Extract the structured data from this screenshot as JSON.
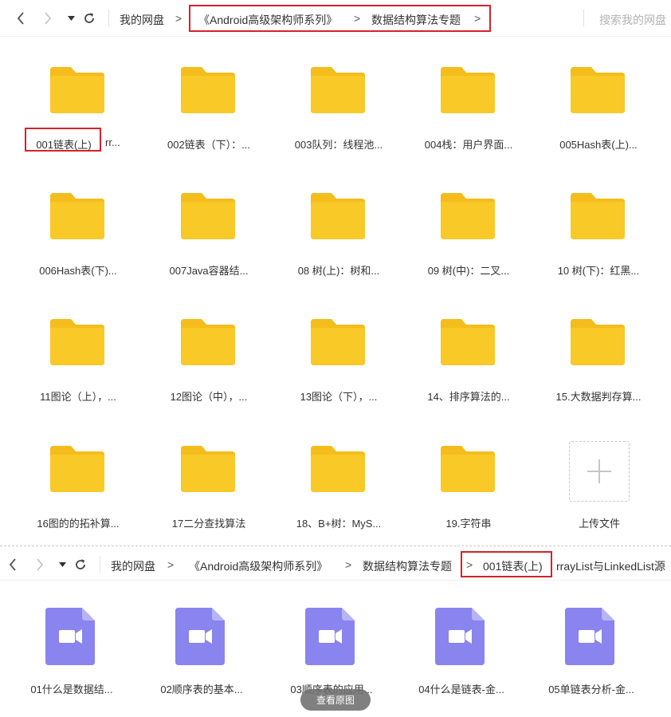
{
  "top_nav": {
    "breadcrumbs": [
      "我的网盘",
      "《Android高级架构师系列》",
      "数据结构算法专题"
    ],
    "separator": ">",
    "search_placeholder": "搜索我的网盘"
  },
  "folders": [
    {
      "name": "001链表(上)",
      "suffix": "rr..."
    },
    {
      "name": "002链表（下）：..."
    },
    {
      "name": "003队列：线程池..."
    },
    {
      "name": "004栈：用户界面..."
    },
    {
      "name": "005Hash表(上)..."
    },
    {
      "name": "006Hash表(下)..."
    },
    {
      "name": "007Java容器结..."
    },
    {
      "name": "08 树(上)：树和..."
    },
    {
      "name": "09 树(中)：二叉..."
    },
    {
      "name": "10 树(下)：红黑..."
    },
    {
      "name": "11图论（上），..."
    },
    {
      "name": "12图论（中），..."
    },
    {
      "name": "13图论（下），..."
    },
    {
      "name": "14、排序算法的..."
    },
    {
      "name": "15.大数据判存算..."
    },
    {
      "name": "16图的的拓补算..."
    },
    {
      "name": "17二分查找算法"
    },
    {
      "name": "18、B+树：MyS..."
    },
    {
      "name": "19.字符串"
    }
  ],
  "upload": {
    "label": "上传文件"
  },
  "second_nav": {
    "breadcrumbs": [
      "我的网盘",
      "《Android高级架构师系列》",
      "数据结构算法专题"
    ],
    "separator": ">",
    "current": "001链表(上)",
    "current_suffix": "rrayList与LinkedList源"
  },
  "videos": [
    {
      "name": "01什么是数据结..."
    },
    {
      "name": "02顺序表的基本..."
    },
    {
      "name": "03顺序表的应用..."
    },
    {
      "name": "04什么是链表-金..."
    },
    {
      "name": "05单链表分析-金..."
    }
  ],
  "overlay": {
    "view_original": "查看原图"
  },
  "colors": {
    "folder": "#f9c928",
    "folder_tab": "#f4bd1c",
    "video": "#8a84ef",
    "highlight": "#d4232b"
  }
}
